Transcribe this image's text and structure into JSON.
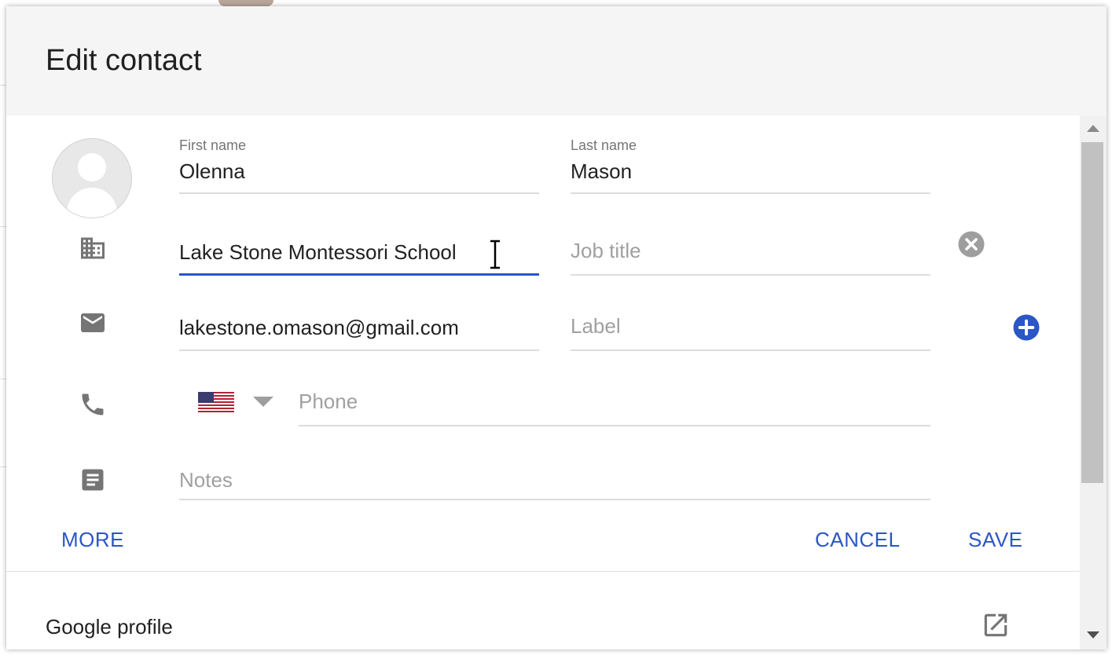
{
  "dialog": {
    "title": "Edit contact"
  },
  "fields": {
    "first_name": {
      "label": "First name",
      "value": "Olenna"
    },
    "last_name": {
      "label": "Last name",
      "value": "Mason"
    },
    "company": {
      "value": "Lake Stone Montessori School"
    },
    "job_title": {
      "placeholder": "Job title"
    },
    "email": {
      "value": "lakestone.omason@gmail.com"
    },
    "email_label": {
      "placeholder": "Label"
    },
    "phone": {
      "placeholder": "Phone",
      "country": "United States"
    },
    "notes": {
      "placeholder": "Notes"
    }
  },
  "buttons": {
    "more": "MORE",
    "cancel": "CANCEL",
    "save": "SAVE"
  },
  "google_profile": {
    "title": "Google profile"
  },
  "colors": {
    "accent": "#2a56c6",
    "header_bg": "#f5f5f5",
    "icon_gray": "#757575"
  },
  "icons": {
    "company": "building-icon",
    "email": "mail-icon",
    "phone": "phone-icon",
    "notes": "notes-icon",
    "clear": "clear-circle-icon",
    "add": "add-circle-icon",
    "open": "open-in-new-icon"
  }
}
